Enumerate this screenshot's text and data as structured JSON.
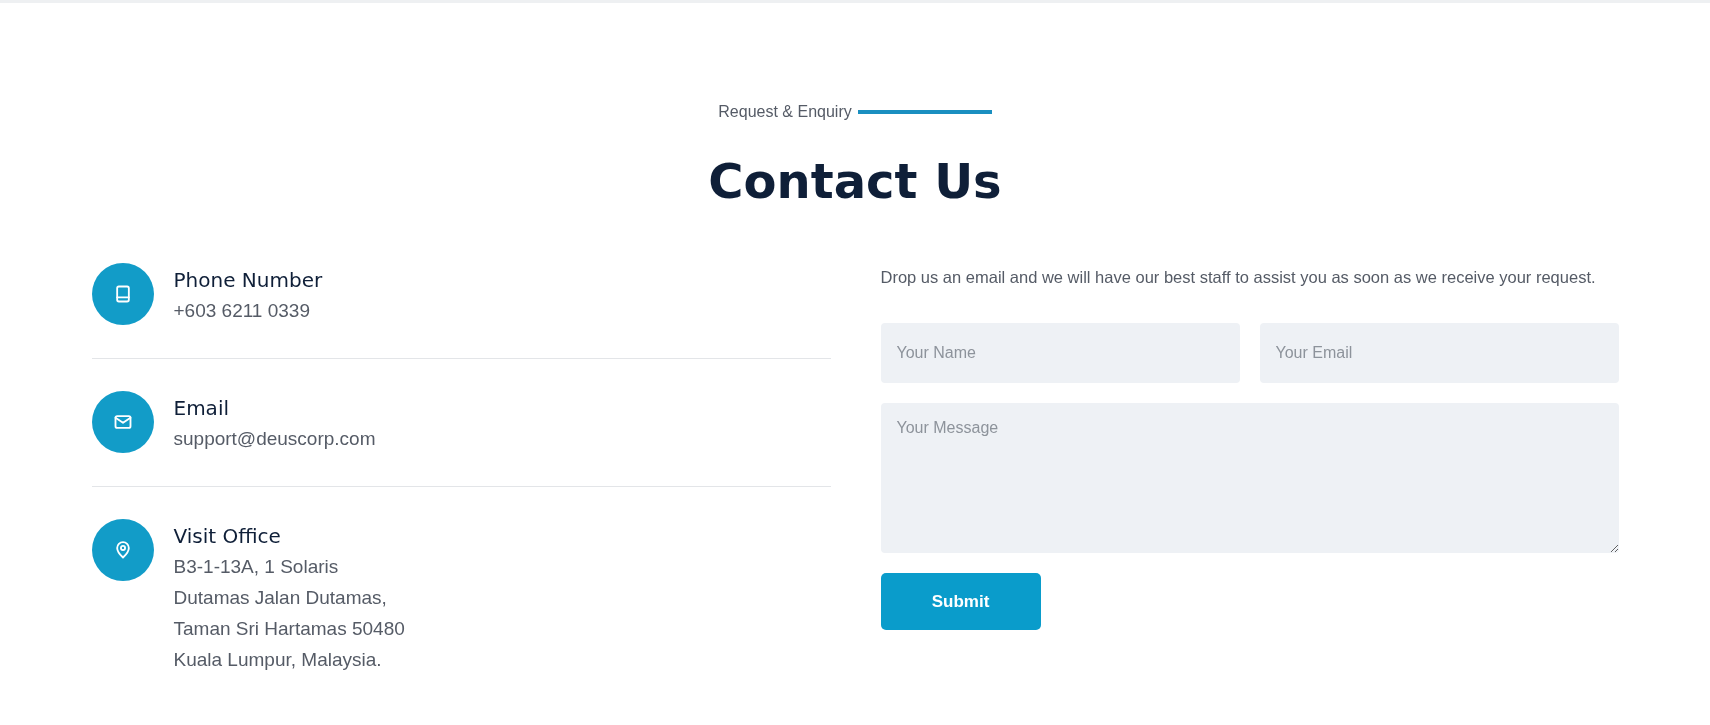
{
  "header": {
    "eyebrow": "Request & Enquiry",
    "title": "Contact Us"
  },
  "contacts": [
    {
      "kind": "phone",
      "title": "Phone Number",
      "lines": [
        "+603 6211 0339"
      ]
    },
    {
      "kind": "email",
      "title": "Email",
      "lines": [
        "support@deuscorp.com"
      ]
    },
    {
      "kind": "location",
      "title": "Visit Office",
      "lines": [
        "B3-1-13A, 1 Solaris",
        "Dutamas Jalan Dutamas,",
        "Taman Sri Hartamas 50480",
        "Kuala Lumpur, Malaysia."
      ]
    }
  ],
  "form": {
    "intro": "Drop us an email and we will have our best staff to assist you as soon as we receive your request.",
    "name_field": {
      "placeholder": "Your Name"
    },
    "email_field": {
      "placeholder": "Your Email"
    },
    "message_field": {
      "placeholder": "Your Message"
    },
    "submit": "Submit"
  }
}
